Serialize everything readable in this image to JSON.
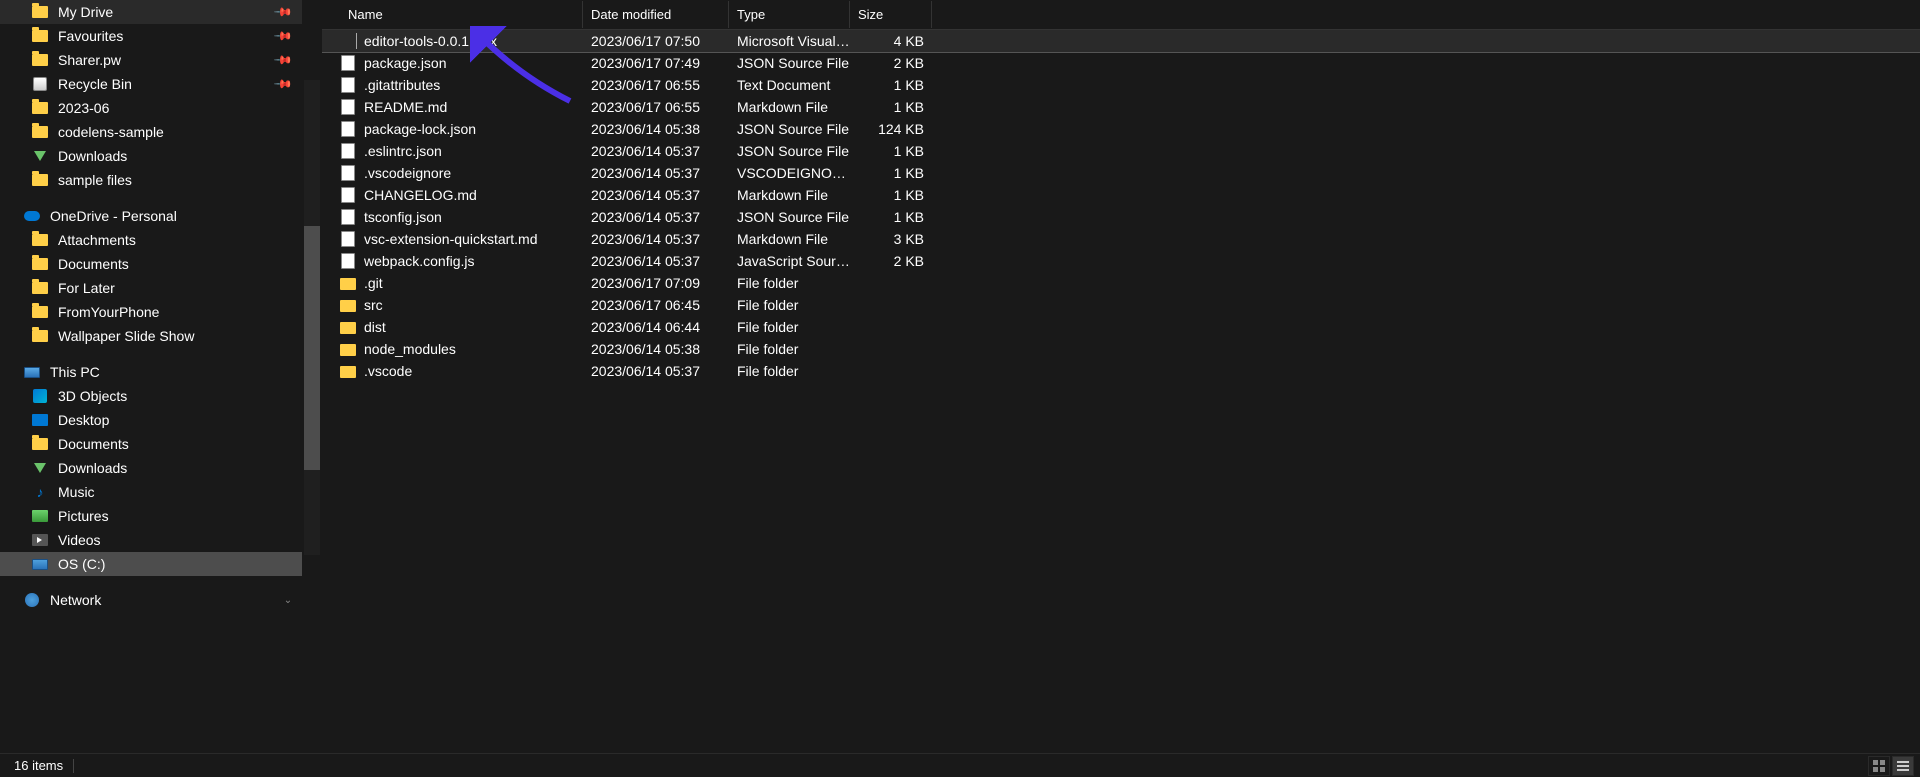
{
  "columns": {
    "name": "Name",
    "date": "Date modified",
    "type": "Type",
    "size": "Size"
  },
  "sidebar": {
    "quick": [
      {
        "label": "My Drive",
        "icon": "folder",
        "pinned": true
      },
      {
        "label": "Favourites",
        "icon": "folder",
        "pinned": true
      },
      {
        "label": "Sharer.pw",
        "icon": "folder",
        "pinned": true
      },
      {
        "label": "Recycle Bin",
        "icon": "recycle",
        "pinned": true
      },
      {
        "label": "2023-06",
        "icon": "folder",
        "pinned": false
      },
      {
        "label": "codelens-sample",
        "icon": "folder",
        "pinned": false
      },
      {
        "label": "Downloads",
        "icon": "download",
        "pinned": false
      },
      {
        "label": "sample files",
        "icon": "folder",
        "pinned": false
      }
    ],
    "onedrive": {
      "label": "OneDrive - Personal",
      "items": [
        {
          "label": "Attachments",
          "icon": "folder"
        },
        {
          "label": "Documents",
          "icon": "folder"
        },
        {
          "label": "For Later",
          "icon": "folder"
        },
        {
          "label": "FromYourPhone",
          "icon": "folder"
        },
        {
          "label": "Wallpaper Slide Show",
          "icon": "folder"
        }
      ]
    },
    "thispc": {
      "label": "This PC",
      "items": [
        {
          "label": "3D Objects",
          "icon": "3d"
        },
        {
          "label": "Desktop",
          "icon": "desktop"
        },
        {
          "label": "Documents",
          "icon": "folder"
        },
        {
          "label": "Downloads",
          "icon": "download"
        },
        {
          "label": "Music",
          "icon": "music"
        },
        {
          "label": "Pictures",
          "icon": "pictures"
        },
        {
          "label": "Videos",
          "icon": "videos"
        },
        {
          "label": "OS (C:)",
          "icon": "drive",
          "selected": true
        }
      ]
    },
    "network": {
      "label": "Network"
    }
  },
  "files": [
    {
      "name": "editor-tools-0.0.1.vsix",
      "date": "2023/06/17 07:50",
      "type": "Microsoft Visual St...",
      "size": "4 KB",
      "icon": "vsix",
      "selected": true
    },
    {
      "name": "package.json",
      "date": "2023/06/17 07:49",
      "type": "JSON Source File",
      "size": "2 KB",
      "icon": "json"
    },
    {
      "name": ".gitattributes",
      "date": "2023/06/17 06:55",
      "type": "Text Document",
      "size": "1 KB",
      "icon": "generic"
    },
    {
      "name": "README.md",
      "date": "2023/06/17 06:55",
      "type": "Markdown File",
      "size": "1 KB",
      "icon": "generic"
    },
    {
      "name": "package-lock.json",
      "date": "2023/06/14 05:38",
      "type": "JSON Source File",
      "size": "124 KB",
      "icon": "json"
    },
    {
      "name": ".eslintrc.json",
      "date": "2023/06/14 05:37",
      "type": "JSON Source File",
      "size": "1 KB",
      "icon": "json"
    },
    {
      "name": ".vscodeignore",
      "date": "2023/06/14 05:37",
      "type": "VSCODEIGNORE Fi...",
      "size": "1 KB",
      "icon": "generic"
    },
    {
      "name": "CHANGELOG.md",
      "date": "2023/06/14 05:37",
      "type": "Markdown File",
      "size": "1 KB",
      "icon": "generic"
    },
    {
      "name": "tsconfig.json",
      "date": "2023/06/14 05:37",
      "type": "JSON Source File",
      "size": "1 KB",
      "icon": "json"
    },
    {
      "name": "vsc-extension-quickstart.md",
      "date": "2023/06/14 05:37",
      "type": "Markdown File",
      "size": "3 KB",
      "icon": "generic"
    },
    {
      "name": "webpack.config.js",
      "date": "2023/06/14 05:37",
      "type": "JavaScript Source ...",
      "size": "2 KB",
      "icon": "generic"
    },
    {
      "name": ".git",
      "date": "2023/06/17 07:09",
      "type": "File folder",
      "size": "",
      "icon": "folder"
    },
    {
      "name": "src",
      "date": "2023/06/17 06:45",
      "type": "File folder",
      "size": "",
      "icon": "folder"
    },
    {
      "name": "dist",
      "date": "2023/06/14 06:44",
      "type": "File folder",
      "size": "",
      "icon": "folder"
    },
    {
      "name": "node_modules",
      "date": "2023/06/14 05:38",
      "type": "File folder",
      "size": "",
      "icon": "folder"
    },
    {
      "name": ".vscode",
      "date": "2023/06/14 05:37",
      "type": "File folder",
      "size": "",
      "icon": "folder"
    }
  ],
  "status": {
    "count": "16 items"
  }
}
